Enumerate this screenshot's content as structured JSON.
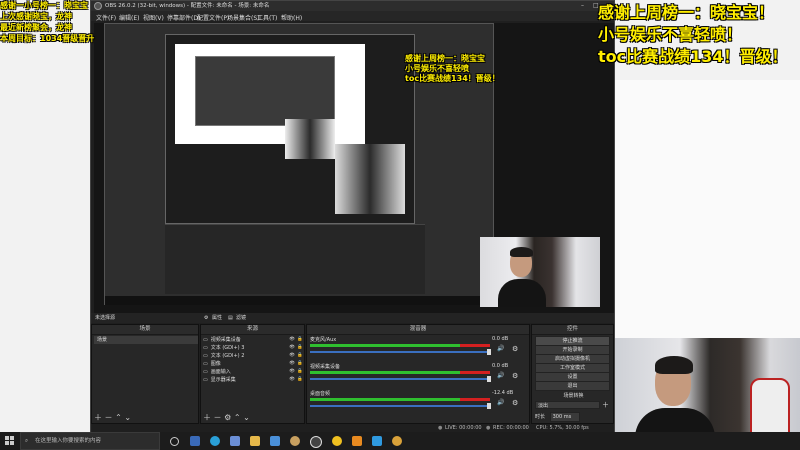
{
  "overlay": {
    "top_left": [
      "感谢一小号榜一：晓宝宝",
      "上次感谢晓宝，龙神",
      "最近新榜聚会，龙神",
      "本周目标：1034晋级晋升"
    ],
    "top_right": [
      "感谢上周榜一：晓宝宝！",
      "小号娱乐不喜轻喷！",
      "toc比赛战绩134！晋级！"
    ],
    "inner_overlay": [
      "感谢上周榜一：晓宝宝",
      "小号娱乐不喜轻喷",
      "toc比赛战绩134！晋级！"
    ]
  },
  "window": {
    "title": "OBS 26.0.2 (32-bit, windows) - 配置文件: 未命名 - 场景: 未命名",
    "menu": [
      "文件(F)",
      "编辑(E)",
      "视图(V)",
      "停靠部件(D)",
      "配置文件(P)",
      "场景集合(S)",
      "工具(T)",
      "帮助(H)"
    ]
  },
  "docks": {
    "scenes_title": "场景",
    "sources_title": "来源",
    "mixer_title": "混音器",
    "controls_title": "控件",
    "transition_title": "未选择源",
    "props_label": "属性",
    "filters_label": "滤镜"
  },
  "scenes": [
    "场景"
  ],
  "sources": [
    "视频采集设备",
    "文本 (GDI+) 3",
    "文本 (GDI+) 2",
    "图像",
    "画面输入",
    "显示器采集"
  ],
  "mixer": {
    "channels": [
      {
        "name": "麦克风/Aux",
        "db": "0.0 dB"
      },
      {
        "name": "视频采集设备",
        "db": "0.0 dB"
      },
      {
        "name": "桌面音频",
        "db": "-12.4 dB"
      }
    ]
  },
  "controls": {
    "buttons": [
      "停止推流",
      "开始录制",
      "启动虚拟摄像机",
      "工作室模式",
      "设置",
      "退出"
    ],
    "transition_label": "场景转换",
    "transition_value": "淡出",
    "duration_label": "时长",
    "duration_value": "300 ms"
  },
  "statusbar": {
    "live": "LIVE: 00:00:00",
    "rec": "REC: 00:00:00",
    "cpu": "CPU: 5.7%, 30.00 fps"
  },
  "taskbar": {
    "search_placeholder": "在这里输入你要搜索的内容",
    "time": "",
    "start_icon": "windows-logo-icon"
  },
  "colors": {
    "obs_bg": "#1f1f1f",
    "panel_bg": "#272727",
    "meter_green": "#2fbf2f",
    "meter_red": "#d42020",
    "overlay_yellow": "#ffee00",
    "taskbar_bg": "#1c1c1c"
  }
}
